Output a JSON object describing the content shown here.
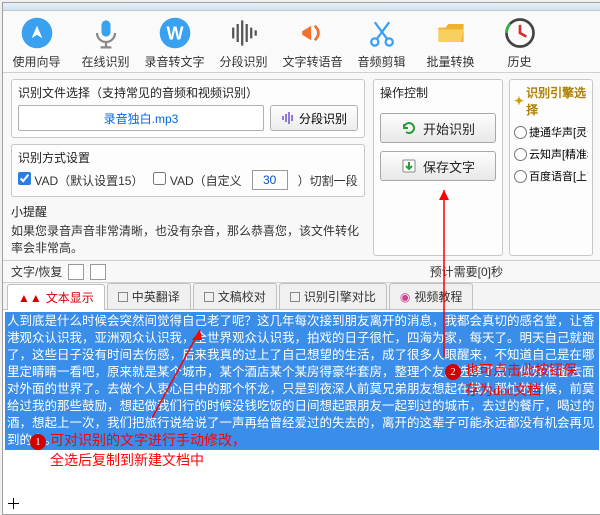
{
  "toolbar": [
    {
      "name": "nav",
      "label": "使用向导"
    },
    {
      "name": "online",
      "label": "在线识别"
    },
    {
      "name": "rec2text",
      "label": "录音转文字"
    },
    {
      "name": "segment",
      "label": "分段识别"
    },
    {
      "name": "text2voice",
      "label": "文字转语音"
    },
    {
      "name": "audioedit",
      "label": "音频剪辑"
    },
    {
      "name": "batch",
      "label": "批量转换"
    },
    {
      "name": "history",
      "label": "历史"
    }
  ],
  "filePanel": {
    "title": "识别文件选择（支持常见的音频和视频识别）",
    "filename": "录音独白.mp3",
    "segBtn": "分段识别"
  },
  "modePanel": {
    "title": "识别方式设置",
    "vad1": "VAD（默认设置15）",
    "vad2": "VAD（自定义",
    "vad2num": "30",
    "vad2suffix": "）切割一段"
  },
  "tip": {
    "title": "小提醒",
    "body": "如果您录音声音非常清晰，也没有杂音，那么恭喜您，该文件转化率会非常高。"
  },
  "ctrl": {
    "title": "操作控制",
    "start": "开始识别",
    "save": "保存文字"
  },
  "status": {
    "left": "文字/恢复",
    "right": "预计需要[0]秒"
  },
  "engine": {
    "title": "识别引擎选择",
    "opts": [
      "捷通华声[灵云识",
      "云知声[精准稳定",
      "百度语音[上市集"
    ]
  },
  "tabs": [
    {
      "key": "txt",
      "label": "文本显示",
      "active": true
    },
    {
      "key": "trans",
      "label": "中英翻译"
    },
    {
      "key": "proof",
      "label": "文稿校对"
    },
    {
      "key": "diff",
      "label": "识别引擎对比"
    },
    {
      "key": "video",
      "label": "视频教程"
    }
  ],
  "body_text": "人到底是什么时候会突然间觉得自己老了呢？这几年每次接到朋友离开的消息，我都会真切的感名堂，让香港观众认识我，亚洲观众认识我，全世界观众认识我，拍戏的日子很忙，四海为家，每天了。明天自己就跑了，这些日子没有时间去伤感，后来我真的过上了自己想望的生活，成了很多人眼醒来，不知道自己是在哪里定睛睛一看吧，原来就是某个城市，某个酒店某个某房得豪华套房，整理个友。选择了爱，做好准备去面对外面的世界了。去做个人衷心目中的那个怀龙，只是到夜深人前莫兄弟朋友想起在找人帮忙的时候，前莫给过我的那些鼓励，想起做我们行的时候没钱吃饭的日间想起跟朋友一起到过的城市，去过的餐厅，喝过的酒，想起上一次，我们把旅行说给说了一声再给曾经爱过的失去的，离开的这辈子可能永远都没有机会再见到的人。",
  "annot1": {
    "line1": "可对识别的文字进行手动修改，",
    "line2": "全选后复制到新建文档中"
  },
  "annot2": {
    "line1": "也可点击此按钮保",
    "line2": "存为doc文档"
  }
}
